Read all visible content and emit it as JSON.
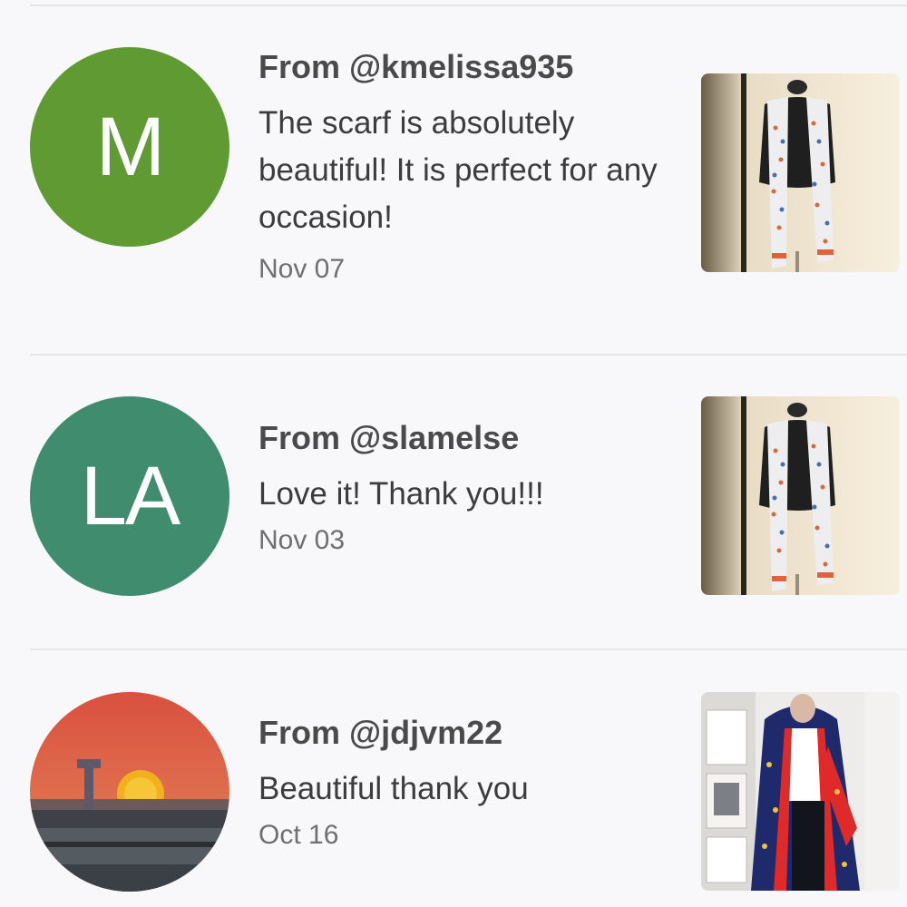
{
  "reviews": [
    {
      "avatar_initials": "M",
      "avatar_color": "#5f9b32",
      "from": "From @kmelissa935",
      "text": "The scarf is absolutely beautiful! It is perfect for any occasion!",
      "date": "Nov 07",
      "thumbnail": "scarf-on-mannequin"
    },
    {
      "avatar_initials": "LA",
      "avatar_color": "#3f8c6f",
      "from": "From @slamelse",
      "text": "Love it! Thank you!!!",
      "date": "Nov 03",
      "thumbnail": "scarf-on-mannequin"
    },
    {
      "avatar_image": "sunset-photo",
      "from": "From @jdjvm22",
      "text": "Beautiful thank you",
      "date": "Oct 16",
      "thumbnail": "person-wearing-scarf"
    }
  ]
}
